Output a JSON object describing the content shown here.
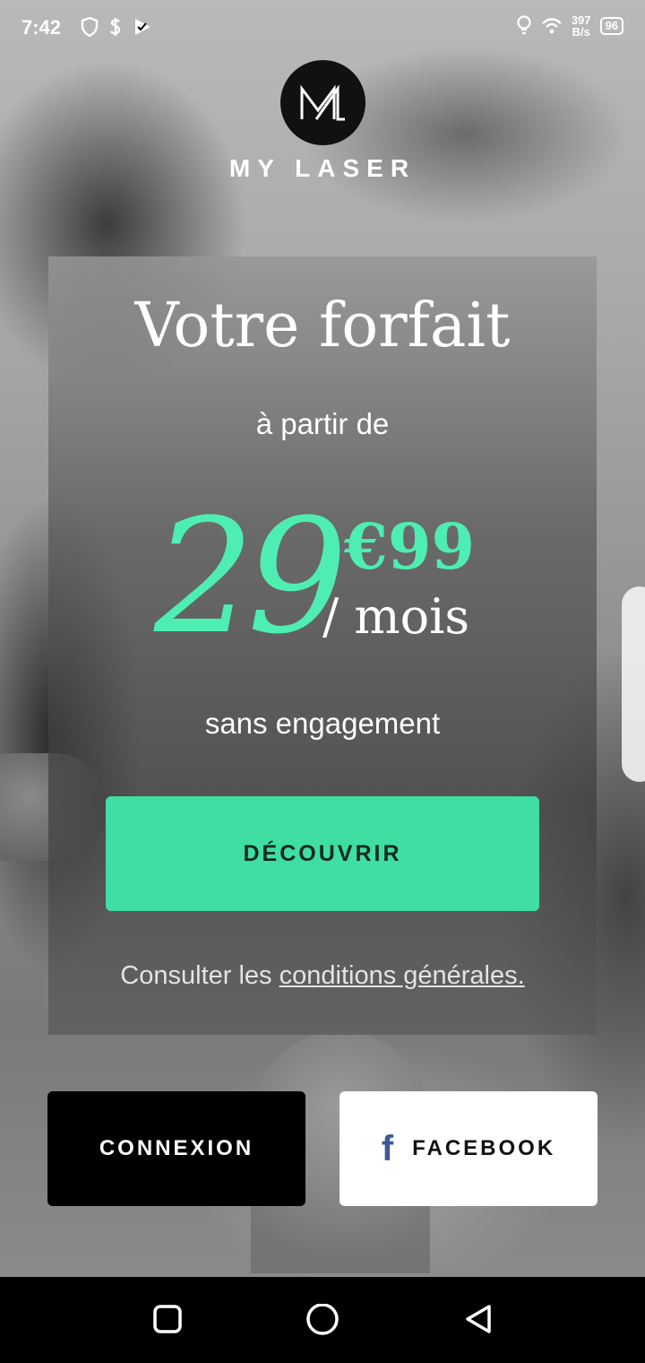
{
  "status_bar": {
    "time": "7:42",
    "speed_value": "397",
    "speed_unit": "B/s",
    "battery": "96"
  },
  "brand": {
    "logo_icon": "ml-monogram",
    "name": "MY LASER"
  },
  "offer": {
    "title": "Votre forfait",
    "subtitle": "à partir de",
    "price_main": "29",
    "price_cents": "€99",
    "price_period": "/ mois",
    "commitment": "sans engagement",
    "cta_label": "DÉCOUVRIR",
    "terms_prefix": "Consulter les ",
    "terms_link": "conditions générales."
  },
  "auth": {
    "login_label": "CONNEXION",
    "facebook_label": "FACEBOOK",
    "facebook_icon": "facebook-f"
  },
  "colors": {
    "accent": "#3fdea3",
    "price": "#4eeeb2",
    "facebook": "#3b5998"
  }
}
